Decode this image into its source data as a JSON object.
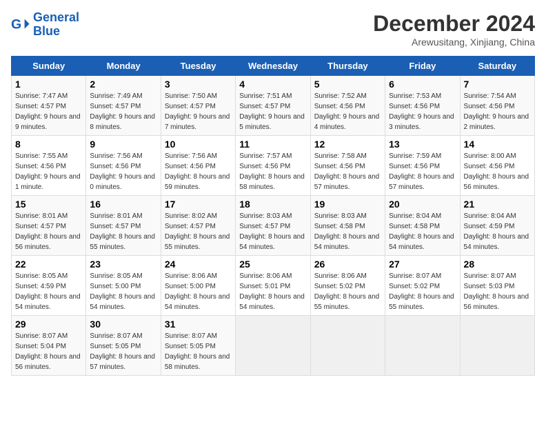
{
  "logo": {
    "line1": "General",
    "line2": "Blue"
  },
  "title": "December 2024",
  "location": "Arewusitang, Xinjiang, China",
  "weekdays": [
    "Sunday",
    "Monday",
    "Tuesday",
    "Wednesday",
    "Thursday",
    "Friday",
    "Saturday"
  ],
  "weeks": [
    [
      {
        "day": 1,
        "sunrise": "7:47 AM",
        "sunset": "4:57 PM",
        "daylight": "9 hours and 9 minutes."
      },
      {
        "day": 2,
        "sunrise": "7:49 AM",
        "sunset": "4:57 PM",
        "daylight": "9 hours and 8 minutes."
      },
      {
        "day": 3,
        "sunrise": "7:50 AM",
        "sunset": "4:57 PM",
        "daylight": "9 hours and 7 minutes."
      },
      {
        "day": 4,
        "sunrise": "7:51 AM",
        "sunset": "4:57 PM",
        "daylight": "9 hours and 5 minutes."
      },
      {
        "day": 5,
        "sunrise": "7:52 AM",
        "sunset": "4:56 PM",
        "daylight": "9 hours and 4 minutes."
      },
      {
        "day": 6,
        "sunrise": "7:53 AM",
        "sunset": "4:56 PM",
        "daylight": "9 hours and 3 minutes."
      },
      {
        "day": 7,
        "sunrise": "7:54 AM",
        "sunset": "4:56 PM",
        "daylight": "9 hours and 2 minutes."
      }
    ],
    [
      {
        "day": 8,
        "sunrise": "7:55 AM",
        "sunset": "4:56 PM",
        "daylight": "9 hours and 1 minute."
      },
      {
        "day": 9,
        "sunrise": "7:56 AM",
        "sunset": "4:56 PM",
        "daylight": "9 hours and 0 minutes."
      },
      {
        "day": 10,
        "sunrise": "7:56 AM",
        "sunset": "4:56 PM",
        "daylight": "8 hours and 59 minutes."
      },
      {
        "day": 11,
        "sunrise": "7:57 AM",
        "sunset": "4:56 PM",
        "daylight": "8 hours and 58 minutes."
      },
      {
        "day": 12,
        "sunrise": "7:58 AM",
        "sunset": "4:56 PM",
        "daylight": "8 hours and 57 minutes."
      },
      {
        "day": 13,
        "sunrise": "7:59 AM",
        "sunset": "4:56 PM",
        "daylight": "8 hours and 57 minutes."
      },
      {
        "day": 14,
        "sunrise": "8:00 AM",
        "sunset": "4:56 PM",
        "daylight": "8 hours and 56 minutes."
      }
    ],
    [
      {
        "day": 15,
        "sunrise": "8:01 AM",
        "sunset": "4:57 PM",
        "daylight": "8 hours and 56 minutes."
      },
      {
        "day": 16,
        "sunrise": "8:01 AM",
        "sunset": "4:57 PM",
        "daylight": "8 hours and 55 minutes."
      },
      {
        "day": 17,
        "sunrise": "8:02 AM",
        "sunset": "4:57 PM",
        "daylight": "8 hours and 55 minutes."
      },
      {
        "day": 18,
        "sunrise": "8:03 AM",
        "sunset": "4:57 PM",
        "daylight": "8 hours and 54 minutes."
      },
      {
        "day": 19,
        "sunrise": "8:03 AM",
        "sunset": "4:58 PM",
        "daylight": "8 hours and 54 minutes."
      },
      {
        "day": 20,
        "sunrise": "8:04 AM",
        "sunset": "4:58 PM",
        "daylight": "8 hours and 54 minutes."
      },
      {
        "day": 21,
        "sunrise": "8:04 AM",
        "sunset": "4:59 PM",
        "daylight": "8 hours and 54 minutes."
      }
    ],
    [
      {
        "day": 22,
        "sunrise": "8:05 AM",
        "sunset": "4:59 PM",
        "daylight": "8 hours and 54 minutes."
      },
      {
        "day": 23,
        "sunrise": "8:05 AM",
        "sunset": "5:00 PM",
        "daylight": "8 hours and 54 minutes."
      },
      {
        "day": 24,
        "sunrise": "8:06 AM",
        "sunset": "5:00 PM",
        "daylight": "8 hours and 54 minutes."
      },
      {
        "day": 25,
        "sunrise": "8:06 AM",
        "sunset": "5:01 PM",
        "daylight": "8 hours and 54 minutes."
      },
      {
        "day": 26,
        "sunrise": "8:06 AM",
        "sunset": "5:02 PM",
        "daylight": "8 hours and 55 minutes."
      },
      {
        "day": 27,
        "sunrise": "8:07 AM",
        "sunset": "5:02 PM",
        "daylight": "8 hours and 55 minutes."
      },
      {
        "day": 28,
        "sunrise": "8:07 AM",
        "sunset": "5:03 PM",
        "daylight": "8 hours and 56 minutes."
      }
    ],
    [
      {
        "day": 29,
        "sunrise": "8:07 AM",
        "sunset": "5:04 PM",
        "daylight": "8 hours and 56 minutes."
      },
      {
        "day": 30,
        "sunrise": "8:07 AM",
        "sunset": "5:05 PM",
        "daylight": "8 hours and 57 minutes."
      },
      {
        "day": 31,
        "sunrise": "8:07 AM",
        "sunset": "5:05 PM",
        "daylight": "8 hours and 58 minutes."
      },
      null,
      null,
      null,
      null
    ]
  ]
}
